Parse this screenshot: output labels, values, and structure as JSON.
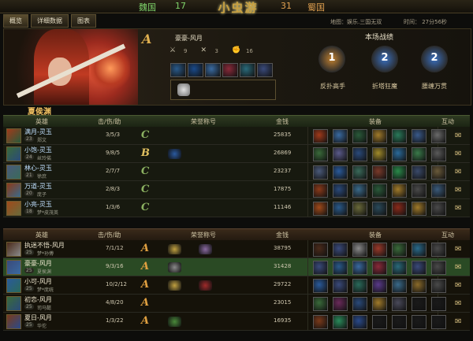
{
  "header": {
    "team_left": "魏国",
    "score_left": "17",
    "logo": "小虫游",
    "score_right": "31",
    "team_right": "蜀国"
  },
  "tabs": [
    {
      "label": "概览"
    },
    {
      "label": "详细数据"
    },
    {
      "label": "图表"
    }
  ],
  "info": {
    "map": "地图：娱乐.三国无双",
    "time": "时间： 27分56秒"
  },
  "hero": {
    "grade": "A",
    "player": "豪豪-风月",
    "kills": "9",
    "deaths": "3",
    "assists": "16",
    "item_colors": [
      "#2a5a8a",
      "#1a4a8a",
      "#3a6aa0",
      "#8a2a3a",
      "#2a6a7a",
      "#3a4a7a"
    ]
  },
  "record": {
    "title": "本场战绩",
    "medals": [
      {
        "num": "1",
        "label": "反扑高手",
        "color": "#c08030"
      },
      {
        "num": "2",
        "label": "折塔狂魔",
        "color": "#3a70c0"
      },
      {
        "num": "2",
        "label": "腰缠万贯",
        "color": "#3a70c0"
      }
    ]
  },
  "player_name": "夏侯渊",
  "columns": {
    "hero": "英雄",
    "kda": "击/伤/助",
    "honor": "荣誉称号",
    "gold": "金钱",
    "equip": "装备",
    "interact": "互动"
  },
  "team_a": [
    {
      "name": "满月-灵玉",
      "level": "23",
      "sub": "郑文",
      "kda": "3/5/3",
      "grade": "C",
      "gold": "25835",
      "name_color": "#c0e0ff",
      "honors": [],
      "eq": [
        "#a03a1a",
        "#3a6aa0",
        "#2a5a3a",
        "#a07a2a",
        "#2a7a5a",
        "#3a5a8a",
        "#6a6a6a"
      ]
    },
    {
      "name": "小饱-灵玉",
      "level": "24",
      "sub": "丝玲偌",
      "kda": "9/8/5",
      "grade": "B",
      "gold": "26869",
      "name_color": "#c0e0ff",
      "honors": [
        "#2a5aa0"
      ],
      "eq": [
        "#3a6a3a",
        "#5a5a8a",
        "#2a4a7a",
        "#a08a2a",
        "#2a6a9a",
        "#3a7a4a",
        "#5a5a5a"
      ]
    },
    {
      "name": "林心-灵玉",
      "level": "21",
      "sub": "徐庶",
      "kda": "2/7/7",
      "grade": "C",
      "gold": "23237",
      "name_color": "#c0e0ff",
      "honors": [],
      "eq": [
        "#4a5a7a",
        "#2a5a9a",
        "#3a6a5a",
        "#7a3a2a",
        "#2a8a4a",
        "#3a4a6a",
        "#6a5a3a"
      ]
    },
    {
      "name": "万道-灵玉",
      "level": "20",
      "sub": "庞子",
      "kda": "2/8/3",
      "grade": "C",
      "gold": "17875",
      "name_color": "#c0e0ff",
      "honors": [],
      "eq": [
        "#8a3a1a",
        "#2a4a7a",
        "#3a6a8a",
        "#2a5a3a",
        "#a07a2a",
        "#4a4a4a",
        "#3a5a7a"
      ]
    },
    {
      "name": "小亮-灵玉",
      "level": "18",
      "sub": "梦*皮茂英",
      "kda": "1/3/6",
      "grade": "C",
      "gold": "11146",
      "name_color": "#c0e0ff",
      "honors": [],
      "eq": [
        "#a04a1a",
        "#2a5a8a",
        "#6a6a3a",
        "#2a4a5a",
        "#8a2a1a",
        "#a07a2a",
        "#4a4a4a"
      ]
    }
  ],
  "team_b": [
    {
      "name": "执迷不悟-风月",
      "level": "25",
      "sub": "梦*孙傅",
      "kda": "7/1/12",
      "grade": "A",
      "gold": "38795",
      "name_color": "#f0e8d0",
      "honors": [
        "#c0a040",
        "#8a6aa0"
      ],
      "eq": [
        "#4a2a1a",
        "#3a4a7a",
        "#8a8a8a",
        "#9a3a2a",
        "#3a6a3a",
        "#2a6a8a",
        "#4a4a4a"
      ]
    },
    {
      "name": "豪豪-风月",
      "level": "25",
      "sub": "夏侯渊",
      "kda": "9/3/16",
      "grade": "A",
      "gold": "31428",
      "name_color": "#f0e8d0",
      "honors": [
        "#8a8a8a"
      ],
      "eq": [
        "#3a4a7a",
        "#2a5a8a",
        "#3a6aa0",
        "#8a2a3a",
        "#2a6a7a",
        "#3a4a7a",
        "#4a4a4a"
      ]
    },
    {
      "name": "小可-风月",
      "level": "25",
      "sub": "梦*庞统",
      "kda": "10/2/12",
      "grade": "A",
      "gold": "29722",
      "name_color": "#f0e8d0",
      "honors": [
        "#c0a040",
        "#a02a2a"
      ],
      "eq": [
        "#2a5a9a",
        "#3a4a7a",
        "#2a6a5a",
        "#5a3a8a",
        "#3a6a8a",
        "#8a6a2a",
        "#4a4a4a"
      ]
    },
    {
      "name": "初恋-风月",
      "level": "25",
      "sub": "司马懿",
      "kda": "4/8/20",
      "grade": "A",
      "gold": "23015",
      "name_color": "#f0e8d0",
      "honors": [],
      "eq": [
        "#3a6a3a",
        "#6a2a5a",
        "#2a4a7a",
        "#a07a2a",
        "#4a4a5a",
        "#1a1a1a",
        "#1a1a1a"
      ]
    },
    {
      "name": "夏日-风月",
      "level": "25",
      "sub": "华佗",
      "kda": "1/3/22",
      "grade": "A",
      "gold": "16935",
      "name_color": "#f0e8d0",
      "honors": [
        "#4a8a3a"
      ],
      "eq": [
        "#7a3a1a",
        "#2a8a5a",
        "#2a4a8a",
        "#1a1a1a",
        "#1a1a1a",
        "#1a1a1a",
        "#1a1a1a"
      ]
    }
  ],
  "icons": {
    "interact": "scroll-icon",
    "kills": "sword-icon",
    "deaths": "skull-icon",
    "assists": "fist-icon"
  }
}
